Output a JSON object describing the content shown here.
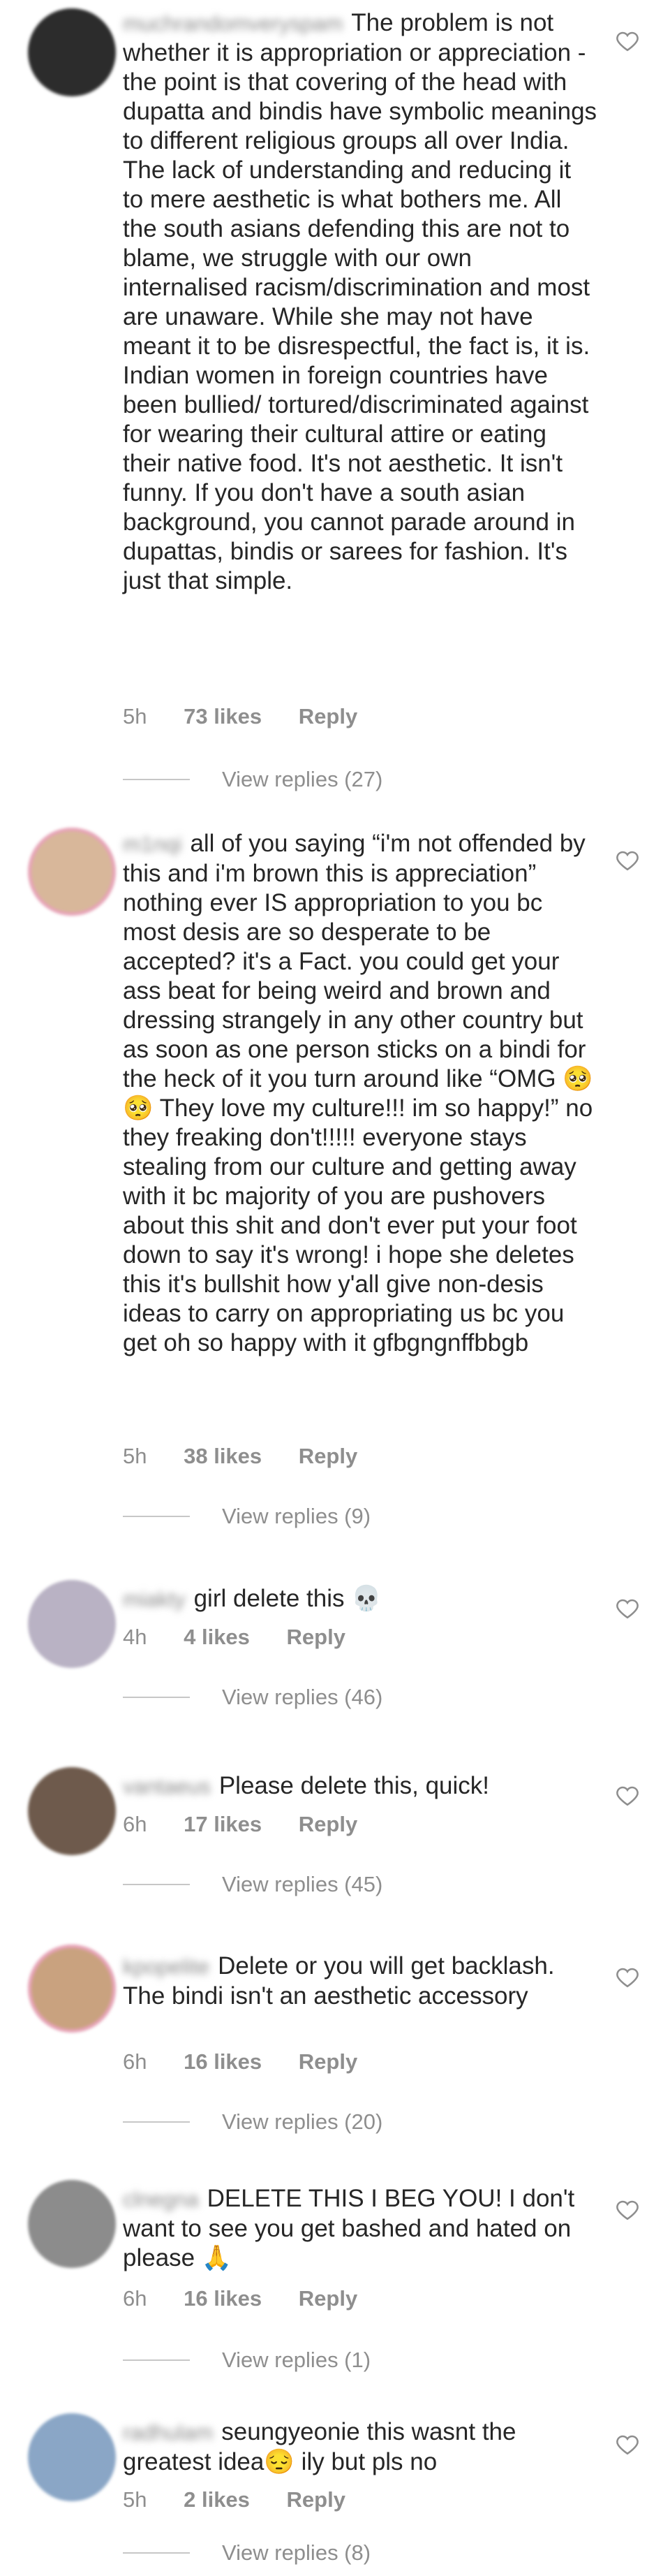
{
  "comments": [
    {
      "username": "muchrandomveryspam",
      "text": "The problem is not whether it is appropriation or appreciation - the point is that covering of the head with dupatta and bindis have symbolic meanings to different religious groups all over India. The lack of understanding and reducing it to mere aesthetic is what bothers me. All the south asians defending this are not to blame, we struggle with our own internalised racism/discrimination and most are unaware. While she may not have meant it to be disrespectful, the fact is, it is. Indian women in foreign countries have been bullied/ tortured/discriminated against for wearing their cultural attire or eating their native food. It's not aesthetic. It isn't funny. If you don't have a south asian background, you cannot parade around in dupattas, bindis or sarees for fashion. It's just that simple.",
      "time": "5h",
      "likes": "73 likes",
      "reply": "Reply",
      "view_replies": "View replies (27)",
      "avatar_color": "#2c2c2c"
    },
    {
      "username": "m1nqi",
      "text": "all of you saying “i'm not offended by this and i'm brown this is appreciation” nothing ever IS appropriation to you bc most desis are so desperate to be accepted? it's a Fact. you could get your ass beat for being weird and brown and dressing strangely in any other country but as soon as one person sticks on a bindi for the heck of it you turn around like “OMG 🥺🥺 They love my culture!!! im so happy!” no they freaking don't!!!!! everyone stays stealing from our culture and getting away with it bc majority of you are pushovers about this shit and don't ever put your foot down to say it's wrong! i hope she deletes this it's bullshit how y'all give non-desis ideas to carry on appropriating us bc you get oh so happy with it gfbgngnffbbgb",
      "time": "5h",
      "likes": "38 likes",
      "reply": "Reply",
      "view_replies": "View replies (9)",
      "avatar_color": "#d8b79a"
    },
    {
      "username": "miakty",
      "text": "girl delete this 💀",
      "time": "4h",
      "likes": "4 likes",
      "reply": "Reply",
      "view_replies": "View replies (46)",
      "avatar_color": "#b9b2c4"
    },
    {
      "username": "vantaeus",
      "text": "Please delete this, quick!",
      "time": "6h",
      "likes": "17 likes",
      "reply": "Reply",
      "view_replies": "View replies (45)",
      "avatar_color": "#6e5a4c"
    },
    {
      "username": "kpopelite",
      "text": "Delete or you will get backlash. The bindi isn't an aesthetic accessory",
      "time": "6h",
      "likes": "16 likes",
      "reply": "Reply",
      "view_replies": "View replies (20)",
      "avatar_color": "#c9a27f"
    },
    {
      "username": "clnegna",
      "text": "DELETE THIS I BEG YOU! I don't want to see you get bashed and hated on please 🙏",
      "time": "6h",
      "likes": "16 likes",
      "reply": "Reply",
      "view_replies": "View replies (1)",
      "avatar_color": "#8c8c8c"
    },
    {
      "username": "radhulam",
      "text": "seungyeonie this wasnt the greatest idea😔 ily but pls no",
      "time": "5h",
      "likes": "2 likes",
      "reply": "Reply",
      "view_replies": "View replies (8)",
      "avatar_color": "#8aa6c6"
    }
  ]
}
